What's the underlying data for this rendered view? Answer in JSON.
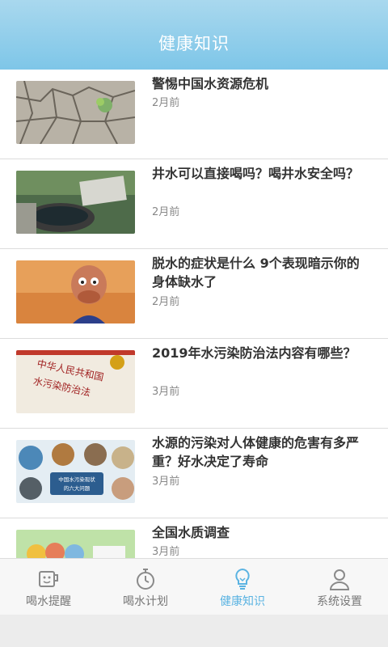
{
  "header": {
    "title": "健康知识"
  },
  "articles": [
    {
      "title": "警惕中国水资源危机",
      "date": "2月前",
      "thumb": "cracked-earth-image"
    },
    {
      "title": "井水可以直接喝吗？喝井水安全吗？",
      "date": "2月前",
      "thumb": "well-water-image"
    },
    {
      "title": "脱水的症状是什么 9个表现暗示你的身体缺水了",
      "date": "2月前",
      "thumb": "thirsty-cartoon-image"
    },
    {
      "title": "2019年水污染防治法内容有哪些？",
      "date": "3月前",
      "thumb": "law-book-image",
      "thumb_text": "中华人民共和国水污染防治法"
    },
    {
      "title": "水源的污染对人体健康的危害有多严重？好水决定了寿命",
      "date": "3月前",
      "thumb": "pollution-infographic-image",
      "thumb_text": "中国水污染现状的六大问题"
    },
    {
      "title": "全国水质调查",
      "date": "3月前",
      "thumb": "water-survey-image"
    }
  ],
  "tabs": [
    {
      "label": "喝水提醒",
      "icon": "cup-icon",
      "active": false
    },
    {
      "label": "喝水计划",
      "icon": "stopwatch-icon",
      "active": false
    },
    {
      "label": "健康知识",
      "icon": "lightbulb-icon",
      "active": true
    },
    {
      "label": "系统设置",
      "icon": "user-icon",
      "active": false
    }
  ],
  "colors": {
    "header": "#7ec6e8",
    "active_tab": "#5ab3e2",
    "inactive_tab": "#777777"
  }
}
